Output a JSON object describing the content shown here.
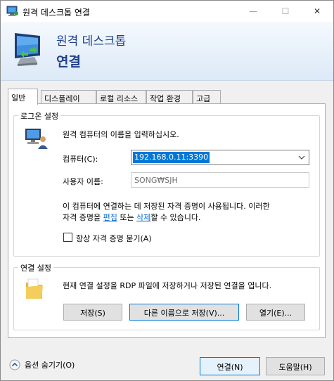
{
  "window": {
    "title": "원격 데스크톱 연결",
    "controls": {
      "minimize": "—",
      "maximize": "☐",
      "close": "✕"
    }
  },
  "banner": {
    "line1": "원격 데스크톱",
    "line2": "연결"
  },
  "tabs": [
    {
      "label": "일반",
      "active": true
    },
    {
      "label": "디스플레이",
      "active": false
    },
    {
      "label": "로컬 리소스",
      "active": false
    },
    {
      "label": "작업 환경",
      "active": false
    },
    {
      "label": "고급",
      "active": false
    }
  ],
  "logon": {
    "legend": "로그온 설정",
    "instruction": "원격 컴퓨터의 이름을 입력하십시오.",
    "computer_label": "컴퓨터(C):",
    "computer_value": "192.168.0.11:3390",
    "username_label": "사용자 이름:",
    "username_value": "SONG₩SJH",
    "info_line1": "이 컴퓨터에 연결하는 데 저장된 자격 증명이 사용됩니다. 이러한",
    "info_line2_pre": "자격 증명을 ",
    "edit_link": "편집",
    "info_line2_mid": " 또는 ",
    "delete_link": "삭제",
    "info_line2_post": "할 수 있습니다.",
    "always_ask_label": "항상 자격 증명 묻기(A)",
    "always_ask_checked": false
  },
  "connection": {
    "legend": "연결 설정",
    "description": "현재 연결 설정을 RDP 파일에 저장하거나 저장된 연결을 엽니다.",
    "save_button": "저장(S)",
    "save_as_button": "다른 이름으로 저장(V)...",
    "open_button": "열기(E)..."
  },
  "footer": {
    "hide_options": "옵션 숨기기(O)",
    "connect_button": "연결(N)",
    "help_button": "도움말(H)"
  },
  "colors": {
    "accent": "#0078d7",
    "banner_text": "#1e3f8a",
    "link": "#0066cc"
  }
}
